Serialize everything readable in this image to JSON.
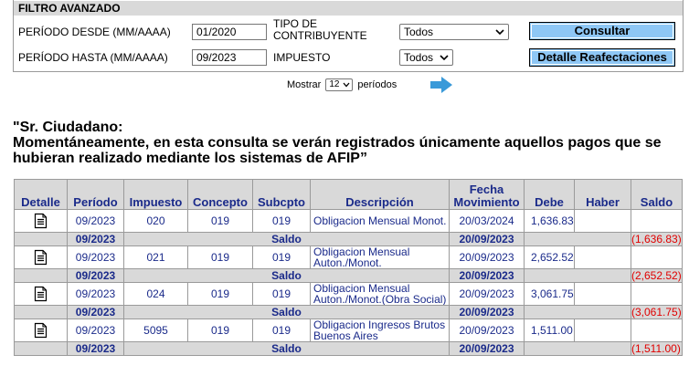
{
  "filter": {
    "title": "FILTRO AVANZADO",
    "desde_label": "PERÍODO DESDE (MM/AAAA)",
    "desde_value": "01/2020",
    "hasta_label": "PERÍODO HASTA (MM/AAAA)",
    "hasta_value": "09/2023",
    "tipo_label_line1": "TIPO DE",
    "tipo_label_line2": "CONTRIBUYENTE",
    "tipo_value": "Todos",
    "impuesto_label": "IMPUESTO",
    "impuesto_value": "Todos",
    "consultar_label": "Consultar",
    "detalle_label": "Detalle Reafectaciones"
  },
  "pager": {
    "mostrar_label": "Mostrar",
    "page_size": "12",
    "periodos_label": "períodos"
  },
  "notice": {
    "line1": "\"Sr. Ciudadano:",
    "line2": "Momentáneamente, en esta consulta se verán registrados únicamente aquellos pagos que se hubieran realizado mediante los sistemas de AFIP”"
  },
  "table": {
    "headers": {
      "detalle": "Detalle",
      "periodo": "Período",
      "impuesto": "Impuesto",
      "concepto": "Concepto",
      "subcpto": "Subcpto",
      "descripcion": "Descripción",
      "fecha_line1": "Fecha",
      "fecha_line2": "Movimiento",
      "debe": "Debe",
      "haber": "Haber",
      "saldo": "Saldo"
    },
    "rows": [
      {
        "periodo": "09/2023",
        "impuesto": "020",
        "concepto": "019",
        "subcpto": "019",
        "desc_line1": "Obligacion Mensual Monot.",
        "desc_line2": "",
        "fecha": "20/03/2024",
        "debe": "1,636.83",
        "haber": "",
        "saldo": "",
        "saldo_periodo": "09/2023",
        "saldo_label": "Saldo",
        "saldo_fecha": "20/09/2023",
        "saldo_value": "(1,636.83)"
      },
      {
        "periodo": "09/2023",
        "impuesto": "021",
        "concepto": "019",
        "subcpto": "019",
        "desc_line1": "Obligacion Mensual",
        "desc_line2": "Auton./Monot.",
        "fecha": "20/09/2023",
        "debe": "2,652.52",
        "haber": "",
        "saldo": "",
        "saldo_periodo": "09/2023",
        "saldo_label": "Saldo",
        "saldo_fecha": "20/09/2023",
        "saldo_value": "(2,652.52)"
      },
      {
        "periodo": "09/2023",
        "impuesto": "024",
        "concepto": "019",
        "subcpto": "019",
        "desc_line1": "Obligacion Mensual",
        "desc_line2": "Auton./Monot.(Obra Social)",
        "fecha": "20/09/2023",
        "debe": "3,061.75",
        "haber": "",
        "saldo": "",
        "saldo_periodo": "09/2023",
        "saldo_label": "Saldo",
        "saldo_fecha": "20/09/2023",
        "saldo_value": "(3,061.75)"
      },
      {
        "periodo": "09/2023",
        "impuesto": "5095",
        "concepto": "019",
        "subcpto": "019",
        "desc_line1": "Obligacion Ingresos Brutos",
        "desc_line2": "Buenos Aires",
        "fecha": "20/09/2023",
        "debe": "1,511.00",
        "haber": "",
        "saldo": "",
        "saldo_periodo": "09/2023",
        "saldo_label": "Saldo",
        "saldo_fecha": "20/09/2023",
        "saldo_value": "(1,511.00)"
      }
    ]
  },
  "colors": {
    "header_bg": "#d9d9d9",
    "button_bg": "#8ec7f5",
    "link_text": "#1a2a8a",
    "negative": "#e00000",
    "arrow": "#3a9ad9"
  },
  "icons": {
    "detail": "document-icon",
    "next": "next-arrow-icon",
    "dropdown": "chevron-down-icon"
  }
}
